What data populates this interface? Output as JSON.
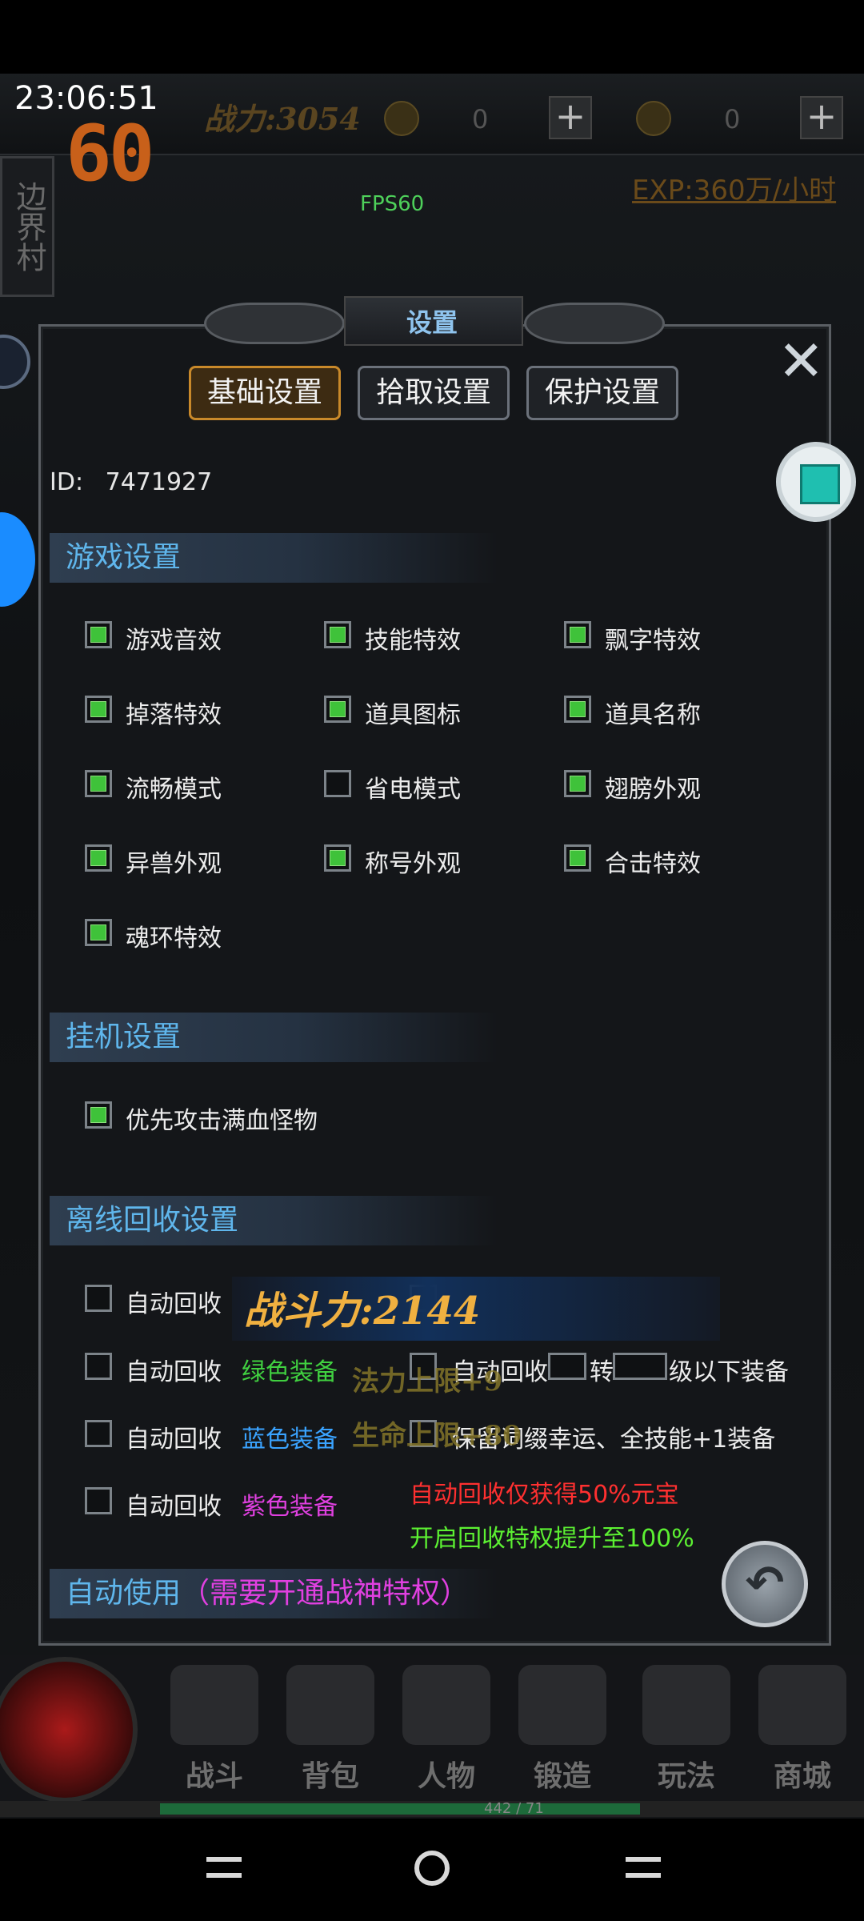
{
  "status": {
    "time": "23:06:51",
    "fps_big": "60"
  },
  "hud": {
    "power": "战力:3054",
    "currency1": "0",
    "currency2": "0",
    "plus": "+",
    "fps_small": "FPS60",
    "exp": "EXP:360万/小时",
    "map_name": "边界村"
  },
  "panel": {
    "title": "设置",
    "close": "✕",
    "tabs": [
      "基础设置",
      "拾取设置",
      "保护设置"
    ],
    "id_label": "ID:",
    "id_value": "7471927",
    "sections": {
      "game": "游戏设置",
      "idle": "挂机设置",
      "recycle": "离线回收设置",
      "auto_use_prefix": "自动使用",
      "auto_use_note": "（需要开通战神特权）"
    },
    "game_options": [
      {
        "label": "游戏音效",
        "checked": true
      },
      {
        "label": "技能特效",
        "checked": true
      },
      {
        "label": "飘字特效",
        "checked": true
      },
      {
        "label": "掉落特效",
        "checked": true
      },
      {
        "label": "道具图标",
        "checked": true
      },
      {
        "label": "道具名称",
        "checked": true
      },
      {
        "label": "流畅模式",
        "checked": true
      },
      {
        "label": "省电模式",
        "checked": false
      },
      {
        "label": "翅膀外观",
        "checked": true
      },
      {
        "label": "异兽外观",
        "checked": true
      },
      {
        "label": "称号外观",
        "checked": true
      },
      {
        "label": "合击特效",
        "checked": true
      },
      {
        "label": "魂环特效",
        "checked": true
      }
    ],
    "idle_options": [
      {
        "label": "优先攻击满血怪物",
        "checked": true
      }
    ],
    "recycle": {
      "auto": "自动回收",
      "green_equip": "绿色装备",
      "blue_equip": "蓝色装备",
      "purple_equip": "紫色装备",
      "turn": "转",
      "level_below": "级以下装备",
      "keep": "保留词缀幸运、全技能+1装备",
      "note_red": "自动回收仅获得50%元宝",
      "note_green": "开启回收特权提升至100%"
    }
  },
  "overlay": {
    "power": "战斗力:2144",
    "line1": "法力上限+9",
    "line2": "生命上限+80"
  },
  "bottom_nav": [
    "战斗",
    "背包",
    "人物",
    "锻造",
    "玩法",
    "商城"
  ],
  "progress_text": "442 / 71",
  "colors": {
    "section_text": "#5fb6ec",
    "checkbox_on": "#3fc23a",
    "tab_active_border": "#c9892a",
    "green_equip": "#40d040",
    "blue_equip": "#3aa3ff",
    "purple_equip": "#e040e0",
    "warn_red": "#ff3030"
  },
  "icons": [
    "close-icon",
    "cube-icon",
    "back-arrow-icon",
    "plus-icon",
    "coin-icon",
    "ingot-icon"
  ]
}
